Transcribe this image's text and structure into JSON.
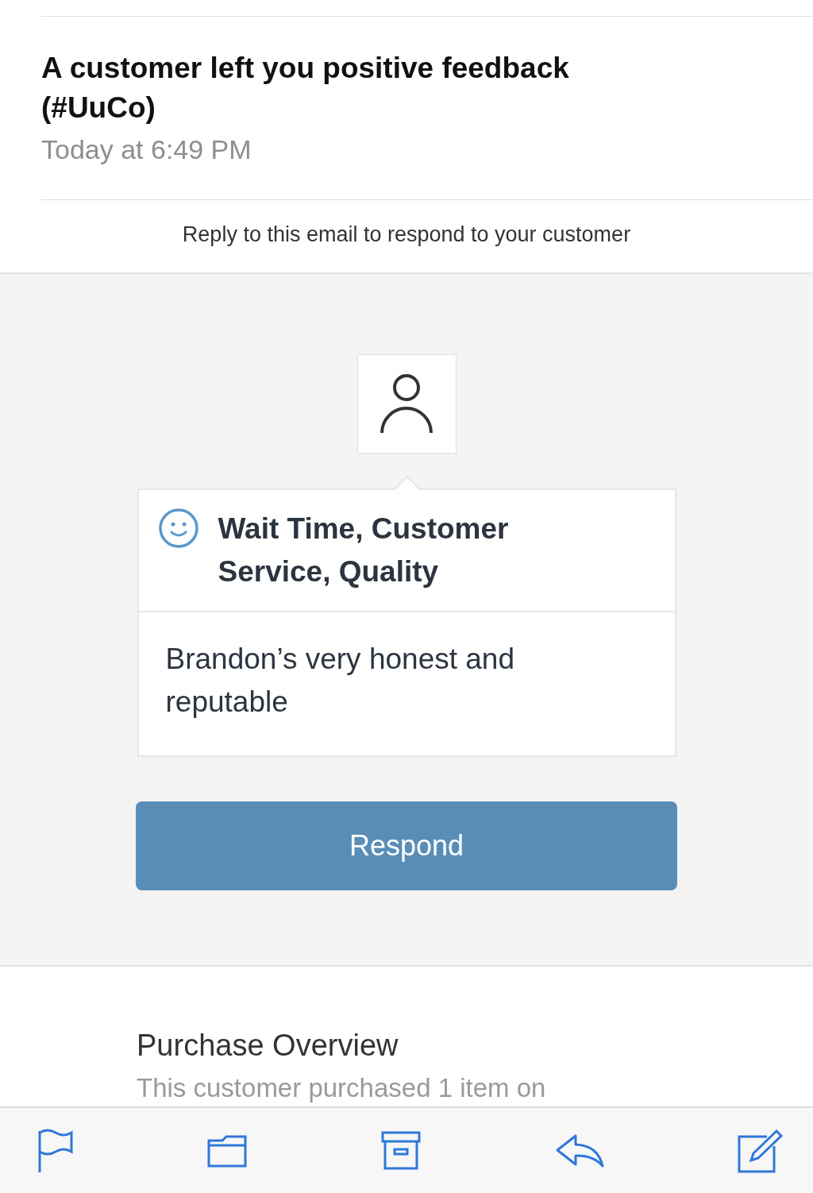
{
  "message": {
    "title": "A customer left you positive feedback (#UuCo)",
    "date": "Today at 6:49 PM",
    "note": "Reply to this email to respond to your customer"
  },
  "feedback": {
    "topics": "Wait Time, Customer Service, Quality",
    "comment": "Brandon’s very honest and reputable",
    "button": "Respond"
  },
  "purchase": {
    "heading": "Purchase Overview",
    "text": "This customer purchased 1 item on"
  },
  "toolbar": [
    {
      "kind": "flag"
    },
    {
      "kind": "folder"
    },
    {
      "kind": "archive"
    },
    {
      "kind": "reply"
    },
    {
      "kind": "compose"
    }
  ]
}
